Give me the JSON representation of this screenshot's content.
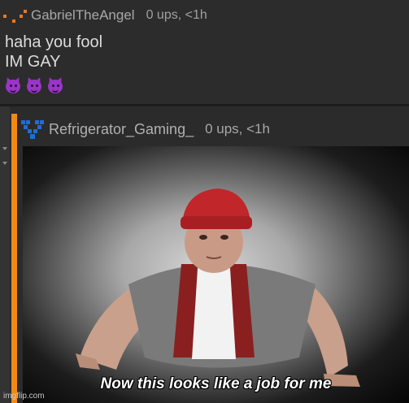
{
  "top_comment": {
    "username": "GabrielTheAngel",
    "meta": "0 ups, <1h",
    "lines": [
      "haha you fool",
      "IM GAY"
    ],
    "emojis": [
      "smiling-imp-emoji",
      "smiling-imp-emoji",
      "smiling-imp-emoji"
    ]
  },
  "reply": {
    "username": "Refrigerator_Gaming_",
    "meta": "0 ups, <1h",
    "meme_caption": "Now this looks like a job for me"
  },
  "watermark": "imgflip.com",
  "colors": {
    "accent": "#f08a16",
    "avatar": "#e8791e",
    "emoji": "#9a35c9",
    "rf_icon": "#1a6fd6"
  }
}
